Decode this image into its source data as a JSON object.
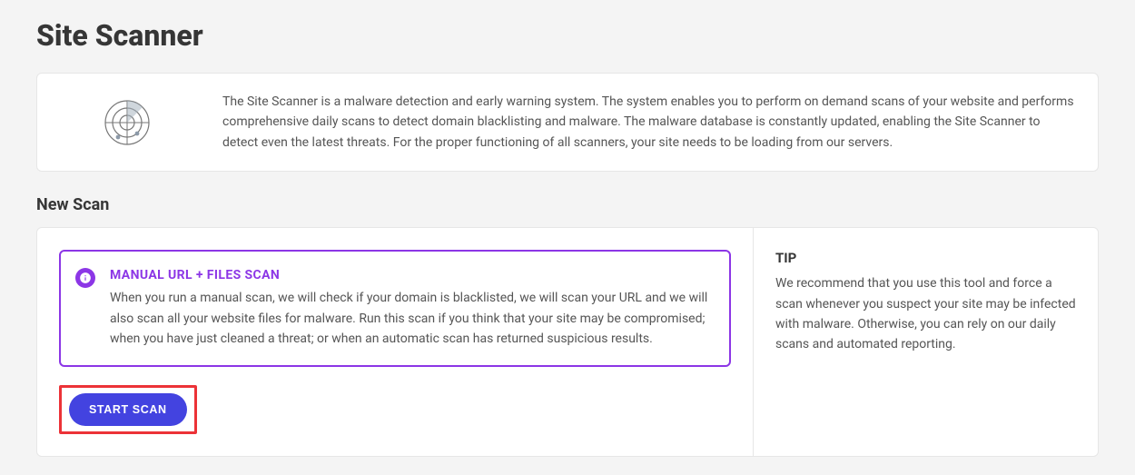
{
  "page": {
    "title": "Site Scanner",
    "intro": "The Site Scanner is a malware detection and early warning system. The system enables you to perform on demand scans of your website and performs comprehensive daily scans to detect domain blacklisting and malware. The malware database is constantly updated, enabling the Site Scanner to detect even the latest threats. For the proper functioning of all scanners, your site needs to be loading from our servers."
  },
  "newScan": {
    "sectionTitle": "New Scan",
    "infoBox": {
      "heading": "MANUAL URL + FILES SCAN",
      "body": "When you run a manual scan, we will check if your domain is blacklisted, we will scan your URL and we will also scan all your website files for malware. Run this scan if you think that your site may be compromised; when you have just cleaned a threat; or when an automatic scan has returned suspicious results."
    },
    "startButton": "START SCAN"
  },
  "tip": {
    "heading": "TIP",
    "body": "We recommend that you use this tool and force a scan whenever you suspect your site may be infected with malware. Otherwise, you can rely on our daily scans and automated reporting."
  }
}
